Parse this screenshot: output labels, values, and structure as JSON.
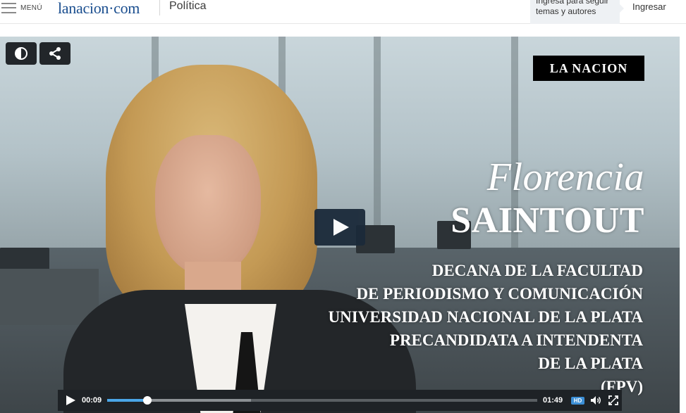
{
  "header": {
    "menu_label": "MENÚ",
    "logo": "lanacion·com",
    "section": "Política",
    "follow_line1": "Ingresá para seguir",
    "follow_line2": "temas y autores",
    "login_label": "Ingresar",
    "brand_color": "#1a4e8f"
  },
  "video": {
    "brand": "LA NACION",
    "name_first": "Florencia",
    "name_last": "SAINTOUT",
    "caption_lines": [
      "DECANA DE LA FACULTAD",
      "DE PERIODISMO Y COMUNICACIÓN",
      "UNIVERSIDAD NACIONAL DE LA PLATA",
      "PRECANDIDATA A INTENDENTA",
      "DE LA PLATA",
      "(FPV)"
    ],
    "buttons": {
      "theme_icon": "contrast-icon",
      "share_icon": "share-icon",
      "play_icon": "play-icon"
    },
    "controls": {
      "current_time": "00:09",
      "duration": "01:49",
      "played_fraction": 0.094,
      "buffered_fraction": 0.335,
      "hd_label": "HD",
      "accent_color": "#4aa6e8"
    }
  }
}
